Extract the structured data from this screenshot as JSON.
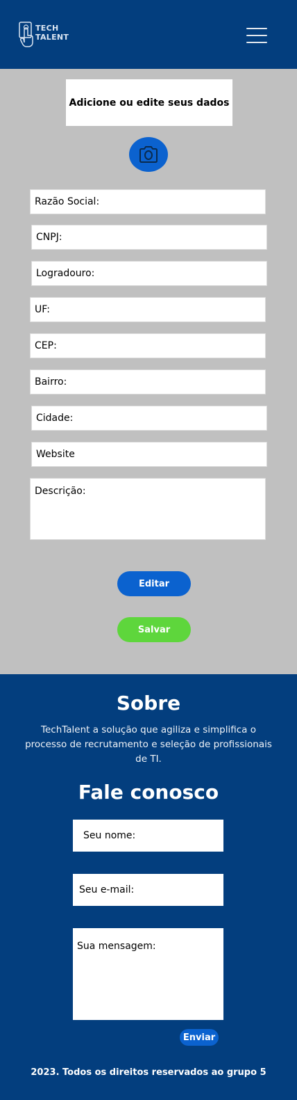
{
  "header": {
    "logo_line1": "TECH",
    "logo_line2": "TALENT",
    "logo_icon": "hand-touch-icon",
    "menu_icon": "hamburger-menu-icon"
  },
  "profile": {
    "title": "Adicione ou edite seus dados",
    "photo_icon": "camera-icon",
    "fields": {
      "razao_social": "Razão Social:",
      "cnpj": "CNPJ:",
      "logradouro": "Logradouro:",
      "uf": "UF:",
      "cep": "CEP:",
      "bairro": "Bairro:",
      "cidade": "Cidade:",
      "website": "Website",
      "descricao": "Descrição:"
    },
    "edit_label": "Editar",
    "save_label": "Salvar"
  },
  "footer": {
    "about_title": "Sobre",
    "about_text": "TechTalent a solução que agiliza e simplifica o processo de recrutamento e seleção de profissionais de TI.",
    "contact_title": "Fale conosco",
    "name_placeholder": "Seu nome:",
    "email_placeholder": "Seu e-mail:",
    "message_placeholder": "Sua mensagem:",
    "send_label": "Enviar",
    "copyright": "2023. Todos os direitos reservados ao grupo 5"
  },
  "colors": {
    "primary_dark": "#033e7e",
    "accent_blue": "#0b62cf",
    "save_green": "#5ed63c",
    "background_gray": "#c0c0c0"
  }
}
